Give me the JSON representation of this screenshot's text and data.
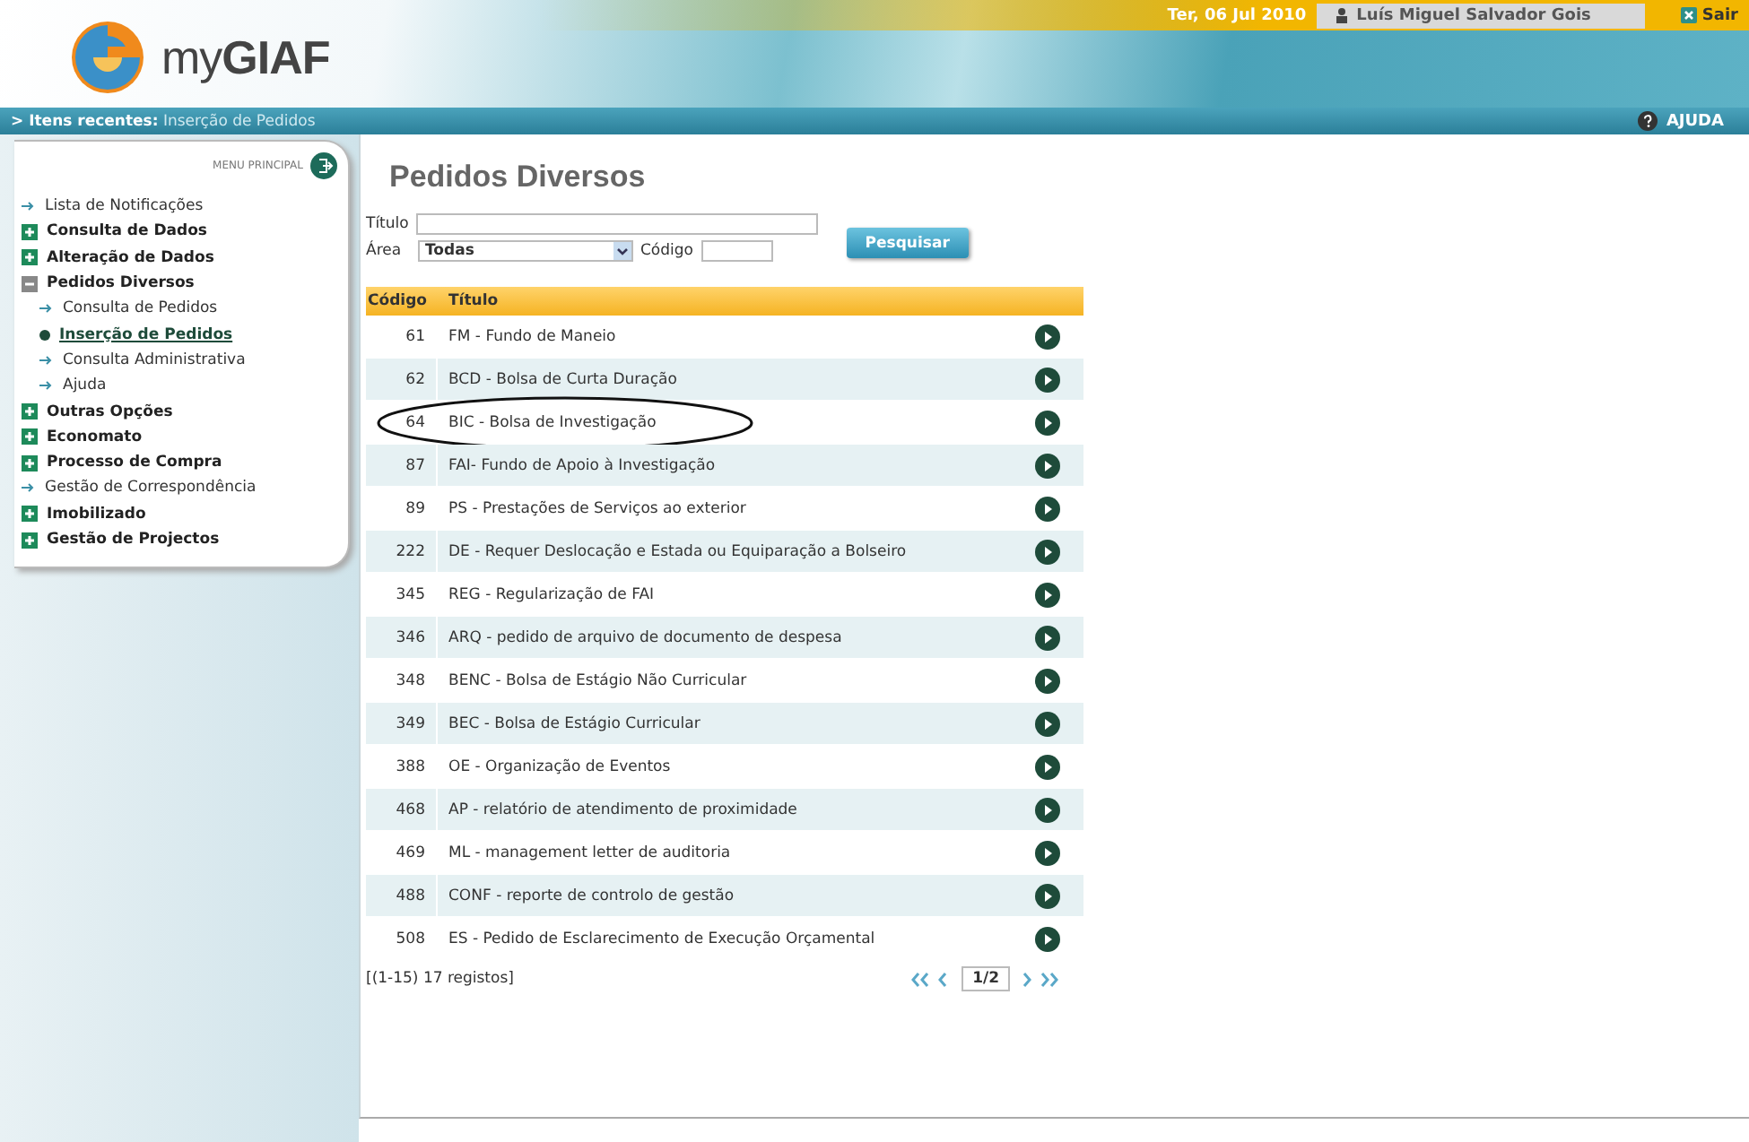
{
  "header": {
    "logo": "myGIAF",
    "date": "Ter, 06 Jul 2010",
    "user": "Luís Miguel Salvador Gois",
    "logout": "Sair",
    "recent": "**> Itens recentes:** Inserção de Pedidos",
    "help": "AJUDA"
  },
  "sidebar": {
    "title": "MENU PRINCIPAL",
    "items": [
      {
        "kind": "link",
        "label": "Lista de Notificações"
      },
      {
        "kind": "group",
        "label": "Consulta de Dados",
        "expanded": false
      },
      {
        "kind": "group",
        "label": "Alteração de Dados",
        "expanded": false
      },
      {
        "kind": "group",
        "label": "Pedidos Diversos",
        "expanded": true,
        "children": [
          {
            "label": "Consulta de Pedidos",
            "selected": false
          },
          {
            "label": "Inserção de Pedidos",
            "selected": true
          },
          {
            "label": "Consulta Administrativa",
            "selected": false
          },
          {
            "label": "Ajuda",
            "selected": false
          }
        ]
      },
      {
        "kind": "group",
        "label": "Outras Opções",
        "expanded": false
      },
      {
        "kind": "group",
        "label": "Economato",
        "expanded": false
      },
      {
        "kind": "group",
        "label": "Processo de Compra",
        "expanded": false
      },
      {
        "kind": "link",
        "label": "Gestão de Correspondência"
      },
      {
        "kind": "group",
        "label": "Imobilizado",
        "expanded": false
      },
      {
        "kind": "group",
        "label": "Gestão de Projectos",
        "expanded": false
      }
    ]
  },
  "main": {
    "title": "Pedidos Diversos",
    "form": {
      "title_label": "Título",
      "area_label": "Área",
      "area_value": "Todas",
      "code_label": "Código",
      "search_button": "Pesquisar"
    },
    "table": {
      "columns": [
        "Código",
        "Título"
      ],
      "rows": [
        {
          "code": "61",
          "title": "FM - Fundo de Maneio",
          "circled": false
        },
        {
          "code": "62",
          "title": "BCD - Bolsa de Curta Duração",
          "circled": false
        },
        {
          "code": "64",
          "title": "BIC - Bolsa de Investigação",
          "circled": true
        },
        {
          "code": "87",
          "title": "FAI- Fundo de Apoio à Investigação",
          "circled": false
        },
        {
          "code": "89",
          "title": "PS - Prestações de Serviços ao exterior",
          "circled": false
        },
        {
          "code": "222",
          "title": "DE - Requer Deslocação e Estada ou Equiparação a Bolseiro",
          "circled": false
        },
        {
          "code": "345",
          "title": "REG - Regularização de FAI",
          "circled": false
        },
        {
          "code": "346",
          "title": "ARQ - pedido de arquivo de documento de despesa",
          "circled": false
        },
        {
          "code": "348",
          "title": "BENC - Bolsa de Estágio Não Curricular",
          "circled": false
        },
        {
          "code": "349",
          "title": "BEC - Bolsa de Estágio Curricular",
          "circled": false
        },
        {
          "code": "388",
          "title": "OE - Organização de Eventos",
          "circled": false
        },
        {
          "code": "468",
          "title": "AP - relatório de atendimento de proximidade",
          "circled": false
        },
        {
          "code": "469",
          "title": "ML - management letter de auditoria",
          "circled": false
        },
        {
          "code": "488",
          "title": "CONF - reporte de controlo de gestão",
          "circled": false
        },
        {
          "code": "508",
          "title": "ES - Pedido de Esclarecimento de Execução Orçamental",
          "circled": false
        }
      ]
    },
    "records": "[(1-15) 17 registos]",
    "page": "1/2"
  }
}
